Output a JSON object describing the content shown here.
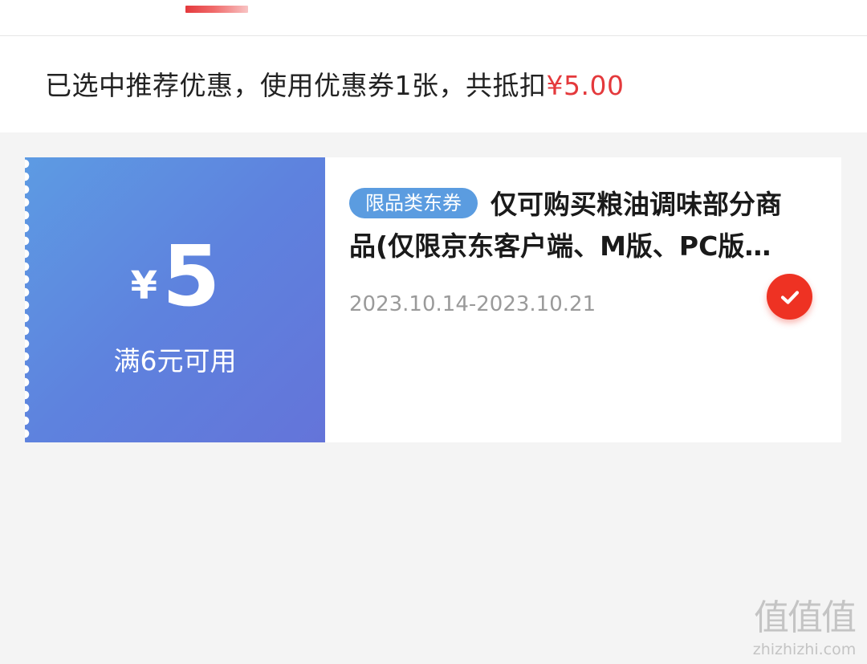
{
  "summary": {
    "text": "已选中推荐优惠，使用优惠券1张，共抵扣",
    "amount": "¥5.00"
  },
  "coupon": {
    "currency": "¥",
    "value": "5",
    "threshold": "满6元可用",
    "badge": "限品类东券",
    "description": "仅可购买粮油调味部分商品(仅限京东客户端、M版、PC版使用)",
    "validity": "2023.10.14-2023.10.21",
    "selected": true,
    "left_gradient": [
      "#5d9be3",
      "#6474d9"
    ],
    "badge_color": "#5b9ce0",
    "check_color": "#ee3223",
    "check_icon": "check-icon"
  },
  "accent_color": "#e4393c",
  "watermark": {
    "glyphs": "值值值",
    "domain": "zhizhizhi.com"
  }
}
